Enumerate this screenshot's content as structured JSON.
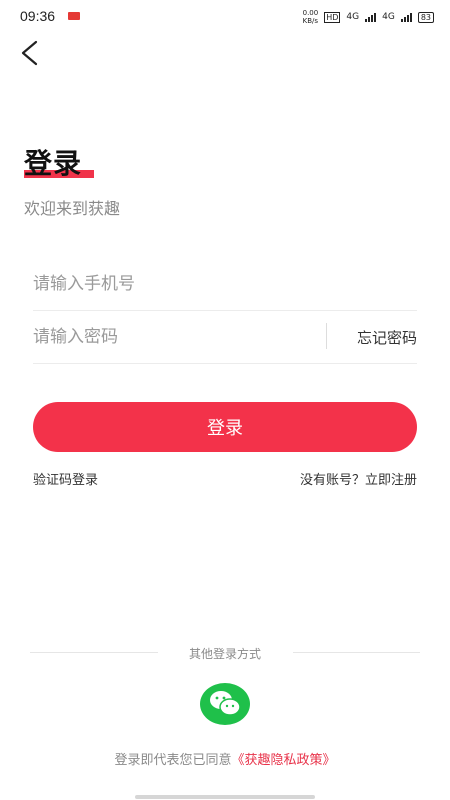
{
  "status_bar": {
    "time": "09:36",
    "net_speed": "0.00\nKB/s",
    "hd": "HD",
    "sig1": "4G",
    "sig2": "4G",
    "battery": "83"
  },
  "header": {
    "title": "登录",
    "subtitle": "欢迎来到获趣"
  },
  "form": {
    "phone_placeholder": "请输入手机号",
    "password_placeholder": "请输入密码",
    "forgot_label": "忘记密码",
    "login_button": "登录",
    "sms_login": "验证码登录",
    "register": "没有账号？立即注册"
  },
  "other": {
    "label": "其他登录方式",
    "wechat_icon": "wechat-icon"
  },
  "policy": {
    "prefix": "登录即代表您已同意",
    "link": "《获趣隐私政策》"
  },
  "colors": {
    "accent": "#f3324a",
    "wechat": "#1fc04a"
  }
}
